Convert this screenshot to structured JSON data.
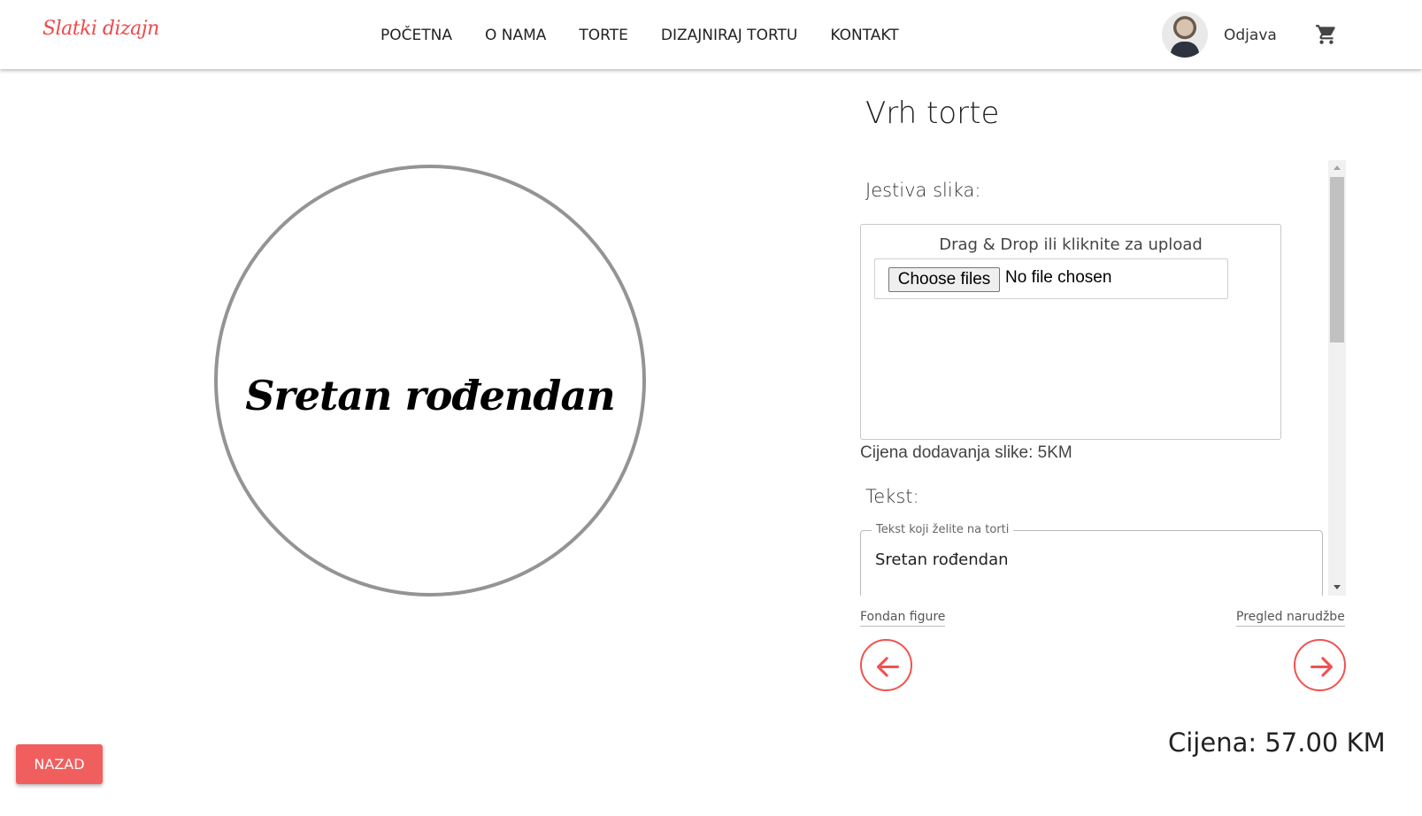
{
  "header": {
    "logo": "Slatki dizajn",
    "nav": [
      "POČETNA",
      "O NAMA",
      "TORTE",
      "DIZAJNIRAJ TORTU",
      "KONTAKT"
    ],
    "logout": "Odjava",
    "cart_icon": "shopping-cart-icon"
  },
  "preview": {
    "cake_text": "Sretan rođendan"
  },
  "panel": {
    "title": "Vrh torte",
    "edible_image_label": "Jestiva slika:",
    "dropzone_text": "Drag & Drop ili kliknite za upload",
    "choose_button": "Choose files",
    "file_status": "No file chosen",
    "image_price": "Cijena dodavanja slike: 5KM",
    "text_label": "Tekst:",
    "text_field_legend": "Tekst koji želite na torti",
    "text_field_value": "Sretan rođendan"
  },
  "navigation": {
    "prev_label": "Fondan figure",
    "next_label": "Pregled narudžbe",
    "prev_icon": "arrow-left-icon",
    "next_icon": "arrow-right-icon"
  },
  "footer": {
    "total": "Cijena: 57.00 KM",
    "back_button": "NAZAD"
  },
  "colors": {
    "accent": "#ef5350",
    "button": "#f15e5e"
  }
}
